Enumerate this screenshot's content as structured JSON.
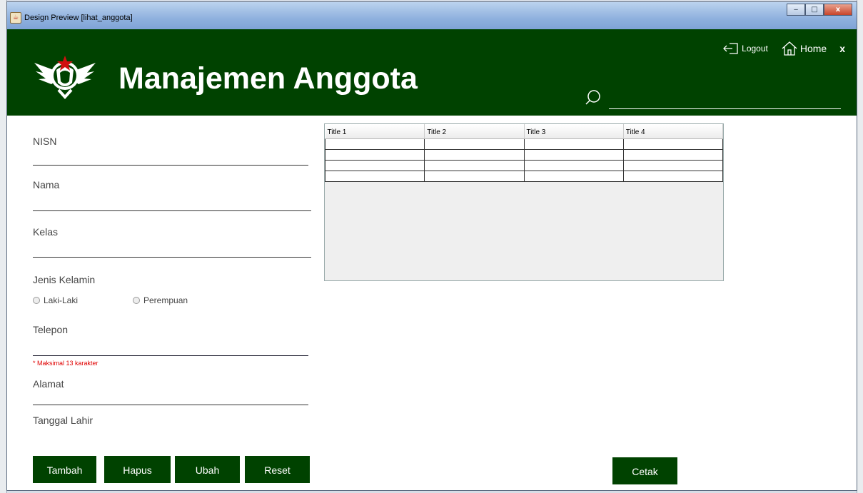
{
  "window": {
    "title": "Design Preview [lihat_anggota]",
    "minimize": "‒",
    "maximize": "□",
    "close": "x"
  },
  "header": {
    "title": "Manajemen Anggota",
    "logout_label": "Logout",
    "home_label": "Home",
    "close_label": "x",
    "search_value": ""
  },
  "form": {
    "nisn_label": "NISN",
    "nama_label": "Nama",
    "kelas_label": "Kelas",
    "jk_label": "Jenis Kelamin",
    "radio_laki": "Laki-Laki",
    "radio_perempuan": "Perempuan",
    "telepon_label": "Telepon",
    "telepon_hint": "* Maksimal 13 karakter",
    "alamat_label": "Alamat",
    "tgl_label": "Tanggal Lahir"
  },
  "buttons": {
    "tambah": "Tambah",
    "hapus": "Hapus",
    "ubah": "Ubah",
    "reset": "Reset",
    "cetak": "Cetak"
  },
  "table": {
    "columns": [
      "Title 1",
      "Title 2",
      "Title 3",
      "Title 4"
    ],
    "rows": [
      [
        "",
        "",
        "",
        ""
      ],
      [
        "",
        "",
        "",
        ""
      ],
      [
        "",
        "",
        "",
        ""
      ],
      [
        "",
        "",
        "",
        ""
      ]
    ]
  },
  "colors": {
    "brand": "#004200",
    "hint": "#e00000"
  }
}
